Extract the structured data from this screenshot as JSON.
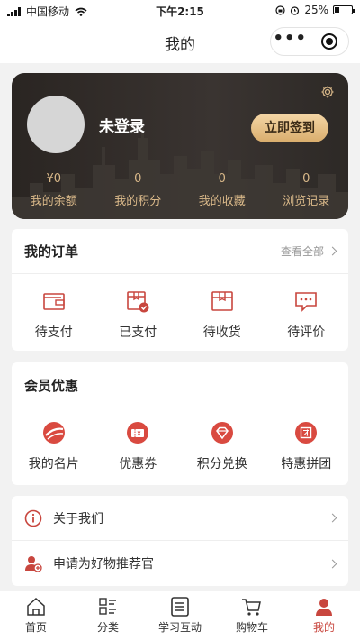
{
  "status_bar": {
    "carrier": "中国移动",
    "time": "下午2:15",
    "battery": "25%",
    "battery_level": 0.25
  },
  "navbar": {
    "title": "我的",
    "more_label": "•••"
  },
  "profile": {
    "username": "未登录",
    "signin_label": "立即签到",
    "stats": [
      {
        "value": "¥0",
        "label": "我的余额"
      },
      {
        "value": "0",
        "label": "我的积分"
      },
      {
        "value": "0",
        "label": "我的收藏"
      },
      {
        "value": "0",
        "label": "浏览记录"
      }
    ]
  },
  "orders": {
    "title": "我的订单",
    "view_all": "查看全部",
    "items": [
      {
        "label": "待支付",
        "icon": "wallet-icon"
      },
      {
        "label": "已支付",
        "icon": "paid-icon"
      },
      {
        "label": "待收货",
        "icon": "box-icon"
      },
      {
        "label": "待评价",
        "icon": "comment-icon"
      }
    ]
  },
  "member": {
    "title": "会员优惠",
    "items": [
      {
        "label": "我的名片",
        "icon": "planet-icon"
      },
      {
        "label": "优惠券",
        "icon": "coupon-icon"
      },
      {
        "label": "积分兑换",
        "icon": "diamond-icon"
      },
      {
        "label": "特惠拼团",
        "icon": "group-icon"
      }
    ]
  },
  "menu": [
    {
      "label": "关于我们",
      "icon": "info-icon"
    },
    {
      "label": "申请为好物推荐官",
      "icon": "user-add-icon"
    }
  ],
  "tabs": [
    {
      "label": "首页",
      "icon": "home-icon"
    },
    {
      "label": "分类",
      "icon": "category-icon"
    },
    {
      "label": "学习互动",
      "icon": "study-icon"
    },
    {
      "label": "购物车",
      "icon": "cart-icon"
    },
    {
      "label": "我的",
      "icon": "profile-icon",
      "active": true
    }
  ],
  "colors": {
    "accent": "#c8463e",
    "gold": "#d9b889",
    "card_dark": "#2f2a27"
  }
}
